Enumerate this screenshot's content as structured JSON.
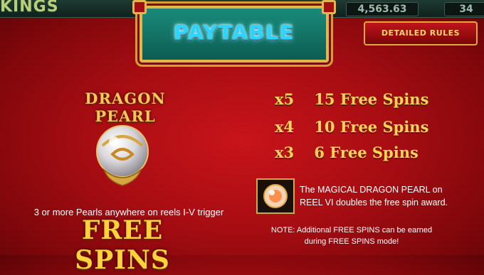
{
  "topbar": {
    "logo_text": "KINGS",
    "credit": "4,563.63",
    "bet": "34"
  },
  "banner": {
    "title": "PAYTABLE"
  },
  "header": {
    "rules_button": "DETAILED RULES"
  },
  "left": {
    "pearl_title": "DRAGON PEARL",
    "trigger_text": "3 or more Pearls anywhere on reels I-V trigger",
    "free_spins_text": "FREE SPINS"
  },
  "awards": [
    {
      "multiplier": "x5",
      "spins": "15 Free Spins"
    },
    {
      "multiplier": "x4",
      "spins": "10 Free Spins"
    },
    {
      "multiplier": "x3",
      "spins": "6 Free Spins"
    }
  ],
  "info": {
    "magical_line1": "The MAGICAL DRAGON PEARL on",
    "magical_line2": "REEL VI doubles the free spin award.",
    "note_line1": "NOTE: Additional FREE SPINS can be earned",
    "note_line2": "during FREE SPINS mode!"
  },
  "colors": {
    "background": "#a60d12",
    "gold": "#ffd35c",
    "banner_teal": "#1a8a7a",
    "title_cyan": "#2ad5ff"
  }
}
